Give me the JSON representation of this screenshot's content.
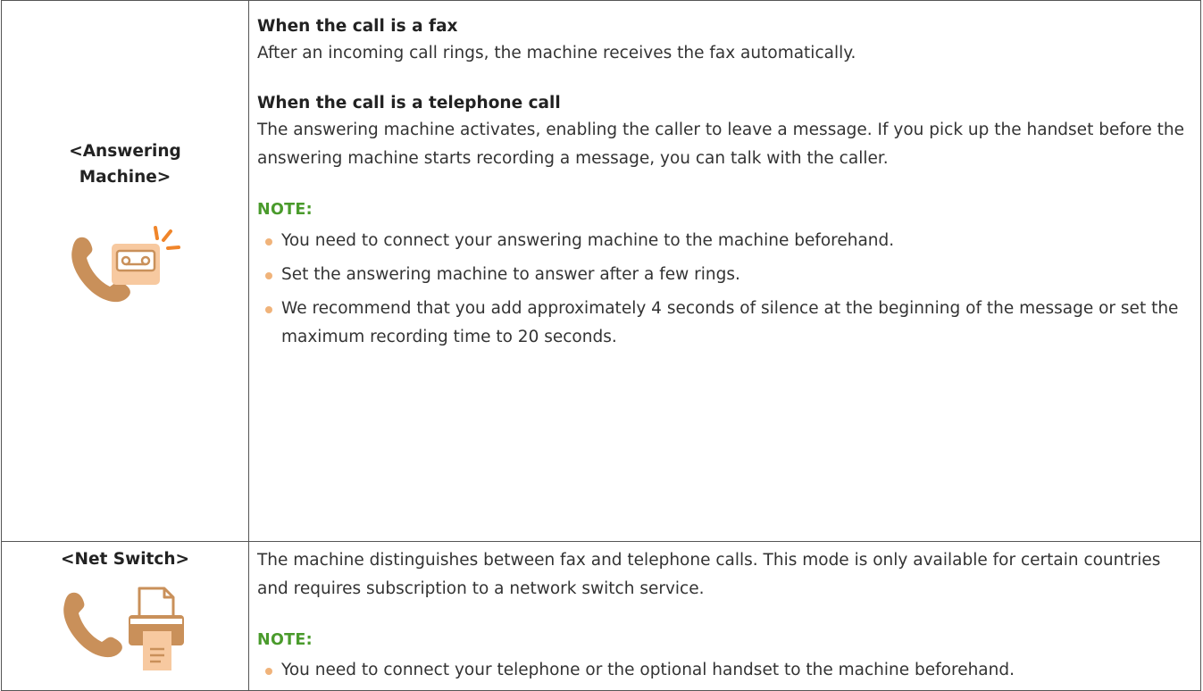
{
  "colors": {
    "border": "#555555",
    "text": "#333333",
    "note_label": "#4a9b2c",
    "bullet": "#f0b37a",
    "icon_brown": "#c9905a",
    "icon_orange": "#f0852a",
    "icon_peach": "#f7c9a0"
  },
  "rows": [
    {
      "mode_name": "<Answering Machine>",
      "icon": "phone-and-answering-machine-icon",
      "sections": [
        {
          "heading": "When the call is a fax",
          "text": "After an incoming call rings, the machine receives the fax automatically."
        },
        {
          "heading": "When the call is a telephone call",
          "text": "The answering machine activates, enabling the caller to leave a message. If you pick up the handset before the answering machine starts recording a message, you can talk with the caller."
        }
      ],
      "note_label": "NOTE:",
      "notes": [
        "You need to connect your answering machine to the machine beforehand.",
        "Set the answering machine to answer after a few rings.",
        "We recommend that you add approximately 4 seconds of silence at the beginning of the message or set the maximum recording time to 20 seconds."
      ]
    },
    {
      "mode_name": "<Net Switch>",
      "icon": "phone-and-fax-machine-icon",
      "description": "The machine distinguishes between fax and telephone calls. This mode is only available for certain countries and requires subscription to a network switch service.",
      "note_label": "NOTE:",
      "notes": [
        "You need to connect your telephone or the optional handset to the machine beforehand."
      ]
    }
  ]
}
